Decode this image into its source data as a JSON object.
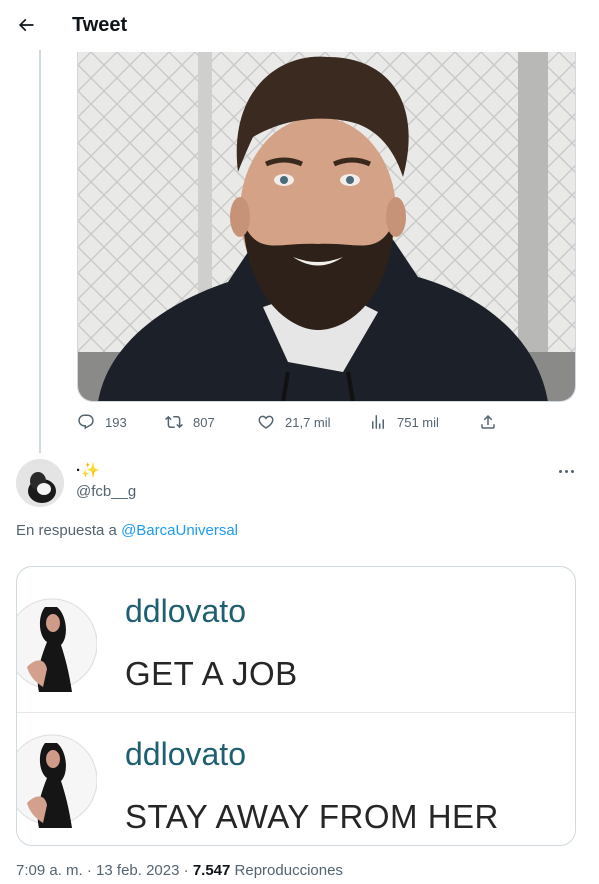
{
  "header": {
    "title": "Tweet"
  },
  "prev_tweet": {
    "stats": {
      "replies": "193",
      "retweets": "807",
      "likes": "21,7 mil",
      "views": "751 mil"
    }
  },
  "reply_tweet": {
    "display_name": "·✨",
    "handle": "@fcb__g",
    "reply_prefix": "En respuesta a",
    "reply_to": "@BarcaUniversal",
    "embedded_image": {
      "rows": [
        {
          "username": "ddlovato",
          "message": "GET A JOB"
        },
        {
          "username": "ddlovato",
          "message": "STAY AWAY FROM HER"
        }
      ]
    },
    "meta": {
      "time": "7:09 a. m.",
      "date": "13 feb. 2023",
      "views_count": "7.547",
      "views_label": "Reproducciones"
    }
  },
  "colors": {
    "accent": "#1d9bf0",
    "secondary_text": "#536471",
    "username_teal": "#1e5f72"
  }
}
